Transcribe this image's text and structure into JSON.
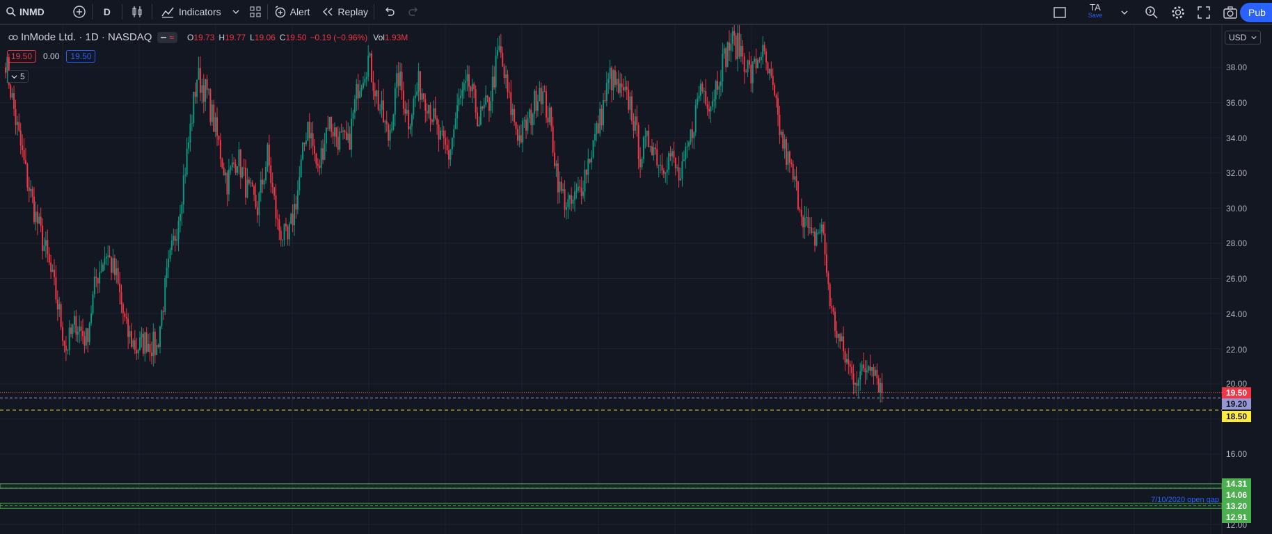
{
  "toolbar": {
    "symbol": "INMD",
    "interval": "D",
    "indicators_label": "Indicators",
    "alert_label": "Alert",
    "replay_label": "Replay",
    "layout_name": "TA",
    "layout_status": "Save",
    "publish_label": "Pub"
  },
  "legend": {
    "title": "InMode Ltd. · 1D · NASDAQ",
    "o_key": "O",
    "o_val": "19.73",
    "h_key": "H",
    "h_val": "19.77",
    "l_key": "L",
    "l_val": "19.06",
    "c_key": "C",
    "c_val": "19.50",
    "change": "−0.19 (−0.96%)",
    "vol_key": "Vol",
    "vol_val": "1.93M",
    "sell_price": "19.50",
    "spread": "0.00",
    "buy_price": "19.50",
    "indicators_collapsed_count": "5"
  },
  "axis": {
    "currency": "USD",
    "labels": [
      "38.00",
      "36.00",
      "34.00",
      "32.00",
      "30.00",
      "28.00",
      "26.00",
      "24.00",
      "22.00",
      "20.00",
      "16.00",
      "12.00"
    ]
  },
  "price_badges": [
    {
      "value": "19.50",
      "bg": "#f23645",
      "fg": "#ffffff"
    },
    {
      "value": "19.20",
      "bg": "#9598d3",
      "fg": "#131722"
    },
    {
      "value": "18.50",
      "bg": "#ffeb3b",
      "fg": "#131722"
    },
    {
      "value": "14.31",
      "bg": "#4caf50",
      "fg": "#ffffff"
    },
    {
      "value": "14.06",
      "bg": "#4caf50",
      "fg": "#ffffff"
    },
    {
      "value": "13.20",
      "bg": "#4caf50",
      "fg": "#ffffff"
    },
    {
      "value": "12.91",
      "bg": "#4caf50",
      "fg": "#ffffff"
    }
  ],
  "annotations": {
    "gap_label": "7/10/2020 open gap"
  },
  "colors": {
    "background": "#131722",
    "up_candle": "#089981",
    "down_candle": "#f23645",
    "grid": "#1e222d",
    "accent": "#2962ff"
  },
  "chart_data": {
    "type": "candlestick",
    "y_range": [
      12.0,
      39.5
    ],
    "horizontal_levels": [
      19.5,
      19.2,
      18.5,
      14.31,
      14.06,
      13.2,
      12.91
    ],
    "close_path": [
      38.5,
      35,
      32,
      29.5,
      27.5,
      25,
      22,
      23.5,
      22.5,
      26,
      27.5,
      26,
      23,
      22,
      22.5,
      22,
      26,
      29,
      33,
      37.5,
      36.5,
      34,
      31.5,
      33,
      31,
      30,
      33,
      29,
      28,
      31,
      35,
      32,
      35,
      34,
      33.5,
      37,
      38.5,
      36,
      34,
      37.5,
      35,
      37,
      36,
      34,
      33,
      36,
      37,
      35,
      36,
      39,
      36,
      34,
      35,
      37,
      35,
      31,
      30,
      31,
      33,
      35,
      37.5,
      36.5,
      36,
      33,
      34,
      32.5,
      33,
      31.5,
      34,
      37,
      36,
      38,
      39.5,
      39,
      37.5,
      39,
      37,
      34,
      32,
      30,
      28,
      29,
      24,
      22,
      20.5,
      20.5,
      21.5,
      19.5
    ]
  }
}
